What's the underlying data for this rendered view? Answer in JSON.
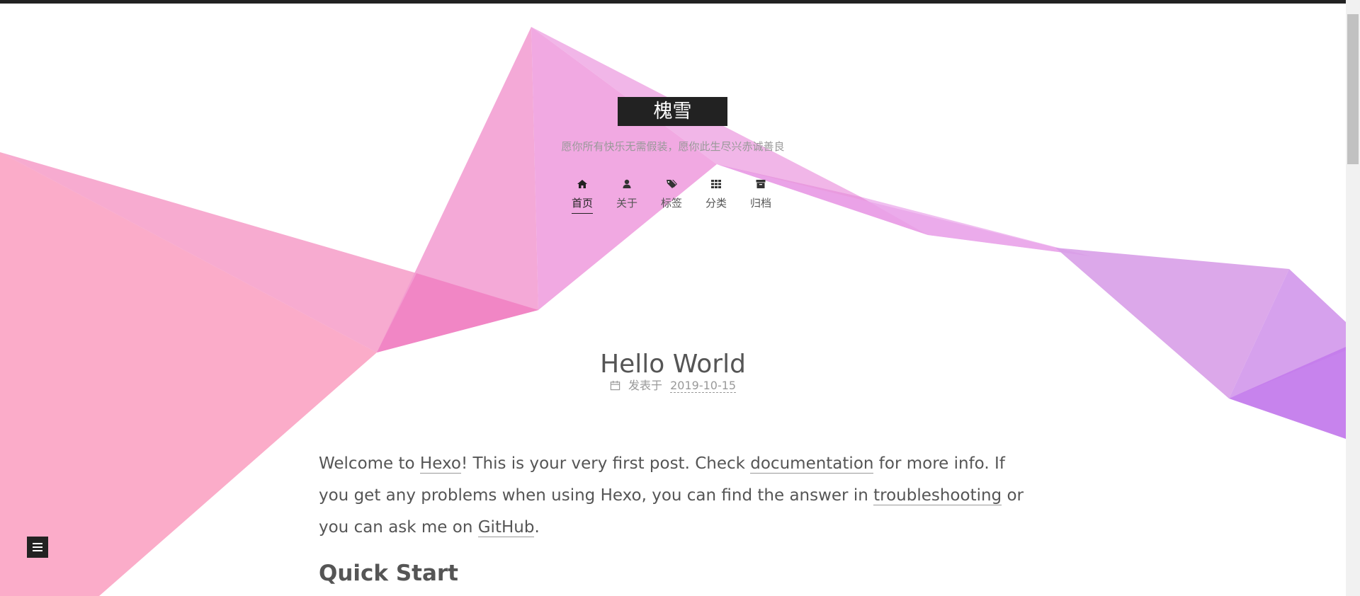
{
  "site": {
    "brand": "槐雪",
    "subtitle": "愿你所有快乐无需假装，愿你此生尽兴赤诚善良"
  },
  "menu": {
    "items": [
      {
        "label": "首页",
        "icon": "home-icon",
        "active": true
      },
      {
        "label": "关于",
        "icon": "user-icon",
        "active": false
      },
      {
        "label": "标签",
        "icon": "tags-icon",
        "active": false
      },
      {
        "label": "分类",
        "icon": "th-icon",
        "active": false
      },
      {
        "label": "归档",
        "icon": "archive-icon",
        "active": false
      }
    ]
  },
  "post": {
    "title": "Hello World",
    "meta_prefix": "发表于",
    "date": "2019-10-15",
    "body": {
      "p1_a": "Welcome to ",
      "link_hexo": "Hexo",
      "p1_b": "! This is your very first post. Check ",
      "link_docs": "documentation",
      "p1_c": " for more info. If you get any problems when using Hexo, you can find the answer in ",
      "link_troubleshooting": "troubleshooting",
      "p1_d": " or you can ask me on ",
      "link_github": "GitHub",
      "p1_e": ".",
      "heading": "Quick Start"
    }
  },
  "colors": {
    "brand_bg": "#222222",
    "pink": "#f7a8c8",
    "purple": "#c77ef0"
  }
}
